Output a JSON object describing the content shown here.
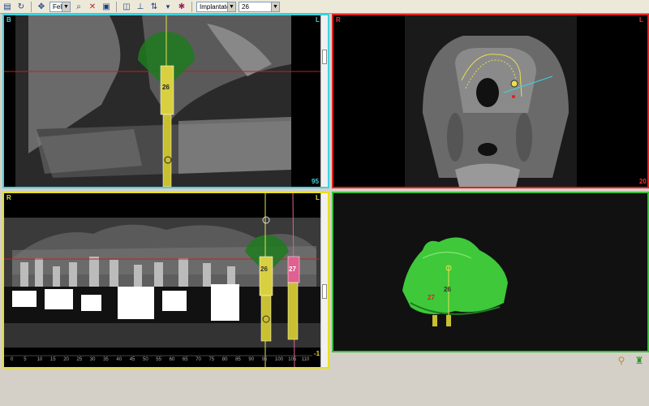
{
  "toolbar": {
    "view_select": "Feld",
    "type_select": "Implantate",
    "number_select": "26"
  },
  "panel_cross": {
    "left_label": "B",
    "right_label": "L",
    "implant_label": "26",
    "slice_number": "95"
  },
  "panel_axial": {
    "left_label": "R",
    "right_label": "L",
    "slice_number": "20"
  },
  "panel_panoramic": {
    "left_label": "R",
    "right_label": "L",
    "implant1_label": "26",
    "implant2_label": "27",
    "corner_number": "-1",
    "ruler_ticks": [
      "0",
      "5",
      "10",
      "15",
      "20",
      "25",
      "30",
      "35",
      "40",
      "45",
      "50",
      "55",
      "60",
      "65",
      "70",
      "75",
      "80",
      "85",
      "90",
      "95",
      "100",
      "105",
      "110"
    ]
  },
  "panel_3d": {
    "implant1_label": "26",
    "implant2_label": "27"
  },
  "icons": [
    "open-icon",
    "refresh-icon",
    "pan-icon",
    "zoom-icon",
    "measure-icon",
    "save-icon",
    "layout-icon",
    "align-icon",
    "rotate-icon",
    "tool-icon",
    "implant-tool-icon",
    "bone-view-icon"
  ],
  "colors": {
    "cross_border": "#3fd3e0",
    "axial_border": "#e02020",
    "pano_border": "#e8e020",
    "model_border": "#39c039",
    "implant_yellow": "#e8e050",
    "implant_pink": "#e06090",
    "model_green": "#3ec83a"
  }
}
